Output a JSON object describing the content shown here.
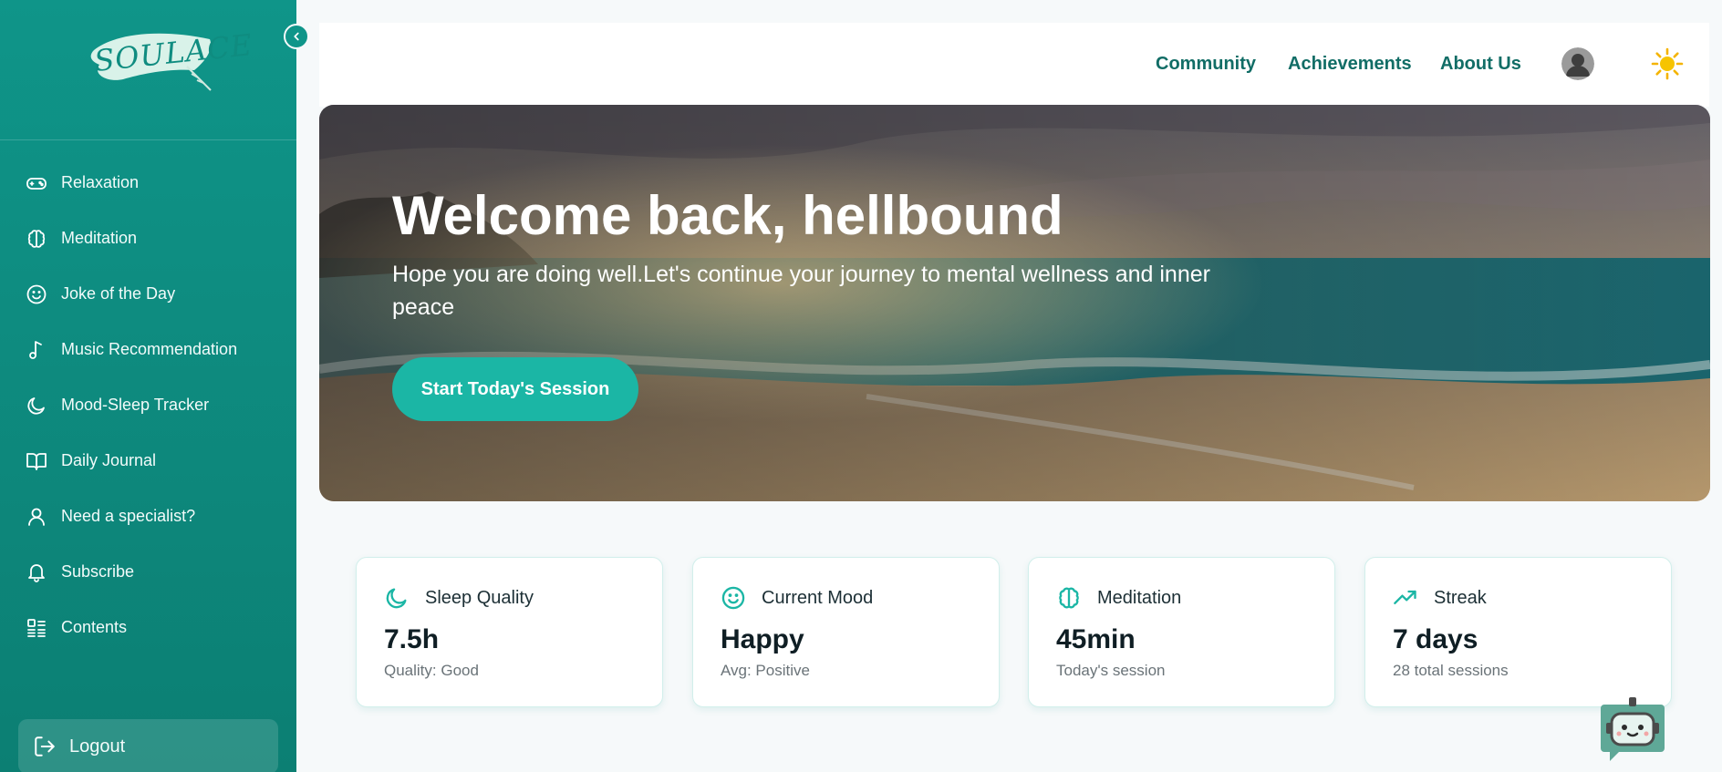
{
  "app": {
    "logo_text": "SOULACE"
  },
  "colors": {
    "sidebar": "#0f9589",
    "accent": "#1bb6a5",
    "header_link": "#116d66"
  },
  "sidebar": {
    "items": [
      {
        "label": "Relaxation",
        "icon": "gamepad-icon"
      },
      {
        "label": "Meditation",
        "icon": "brain-icon"
      },
      {
        "label": "Joke of the Day",
        "icon": "smile-icon"
      },
      {
        "label": "Music Recommendation",
        "icon": "music-note-icon"
      },
      {
        "label": "Mood-Sleep Tracker",
        "icon": "moon-icon"
      },
      {
        "label": "Daily Journal",
        "icon": "book-icon"
      },
      {
        "label": "Need a specialist?",
        "icon": "user-icon"
      },
      {
        "label": "Subscribe",
        "icon": "bell-icon"
      },
      {
        "label": "Contents",
        "icon": "list-icon"
      }
    ],
    "logout_label": "Logout"
  },
  "header": {
    "links": [
      "Community",
      "Achievements",
      "About Us"
    ]
  },
  "hero": {
    "title": "Welcome back, hellbound",
    "subtitle": "Hope you are doing well.Let's continue your journey to mental wellness and inner peace",
    "button": "Start Today's Session"
  },
  "stats": [
    {
      "title": "Sleep Quality",
      "value": "7.5h",
      "sub": "Quality: Good",
      "icon": "moon-icon"
    },
    {
      "title": "Current Mood",
      "value": "Happy",
      "sub": "Avg: Positive",
      "icon": "smile-icon"
    },
    {
      "title": "Meditation",
      "value": "45min",
      "sub": "Today's session",
      "icon": "brain-icon"
    },
    {
      "title": "Streak",
      "value": "7 days",
      "sub": "28 total sessions",
      "icon": "trending-up-icon"
    }
  ]
}
